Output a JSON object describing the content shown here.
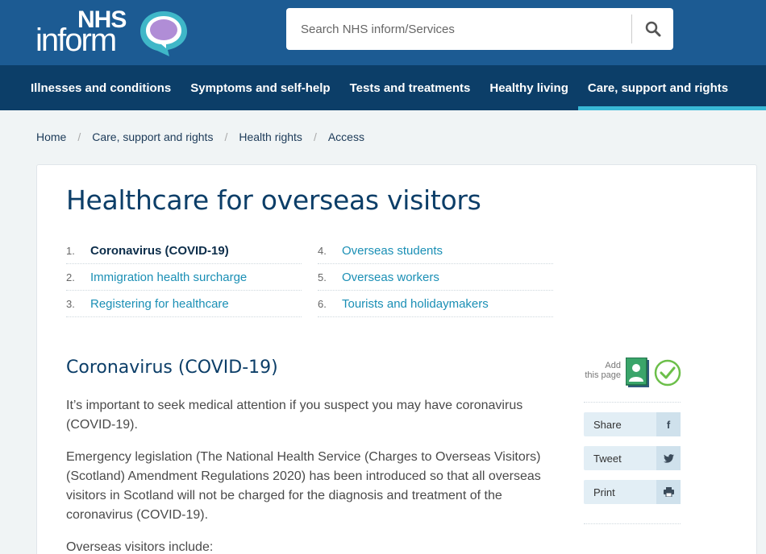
{
  "header": {
    "logo": {
      "nhs": "NHS",
      "inform": "inform"
    },
    "search": {
      "placeholder": "Search NHS inform/Services",
      "icon": "search-icon"
    }
  },
  "nav": {
    "items": [
      {
        "label": "Illnesses and conditions"
      },
      {
        "label": "Symptoms and self-help"
      },
      {
        "label": "Tests and treatments"
      },
      {
        "label": "Healthy living"
      },
      {
        "label": "Care, support and rights",
        "active": true
      }
    ]
  },
  "breadcrumb": [
    "Home",
    "Care, support and rights",
    "Health rights",
    "Access"
  ],
  "page": {
    "title": "Healthcare for overseas visitors",
    "toc": [
      {
        "num": "1.",
        "label": "Coronavirus (COVID-19)",
        "current": true
      },
      {
        "num": "2.",
        "label": "Immigration health surcharge"
      },
      {
        "num": "3.",
        "label": "Registering for healthcare"
      },
      {
        "num": "4.",
        "label": "Overseas students"
      },
      {
        "num": "5.",
        "label": "Overseas workers"
      },
      {
        "num": "6.",
        "label": "Tourists and holidaymakers"
      }
    ],
    "section_heading": "Coronavirus (COVID-19)",
    "paragraphs": [
      "It’s important to seek medical attention if you suspect you may have coronavirus (COVID-19).",
      "Emergency legislation (The National Health Service (Charges to Overseas Visitors) (Scotland) Amendment Regulations 2020) has been introduced so that all overseas visitors in Scotland will not be charged for the diagnosis and treatment of the coronavirus (COVID-19).",
      "Overseas visitors include:"
    ]
  },
  "tools": {
    "add_page": {
      "line1": "Add",
      "line2": "this page"
    },
    "share": {
      "label": "Share",
      "icon": "f"
    },
    "tweet": {
      "label": "Tweet",
      "icon": "twitter-icon"
    },
    "print": {
      "label": "Print",
      "icon": "print-icon"
    }
  },
  "colors": {
    "header_blue": "#1c5b93",
    "nav_dark": "#0c3e68",
    "accent_cyan": "#38b8d6",
    "link": "#1a8fb5",
    "check_green": "#6cbf4a"
  }
}
